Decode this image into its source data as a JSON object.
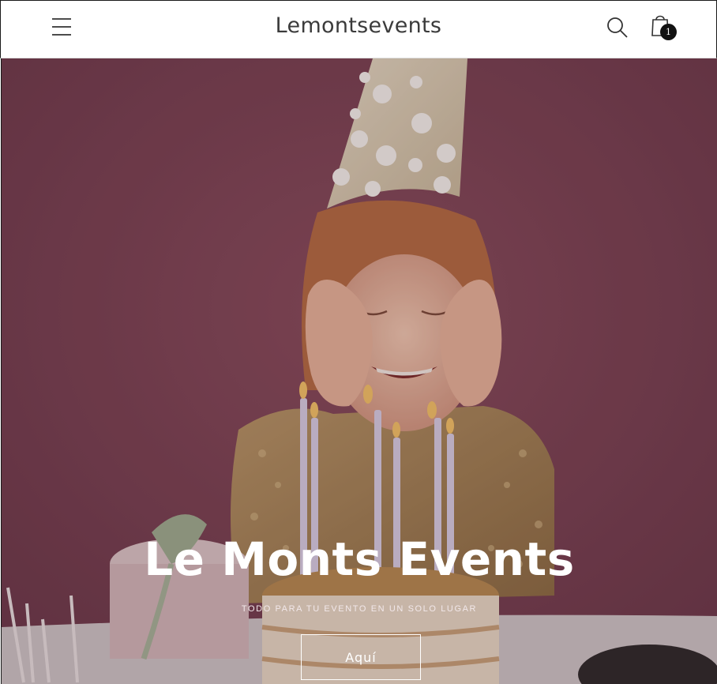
{
  "header": {
    "brand": "Lemontsevents",
    "cart_count": "1",
    "icons": {
      "menu": "hamburger-menu-icon",
      "search": "search-icon",
      "cart": "shopping-bag-icon"
    }
  },
  "hero": {
    "title": "Le Monts Events",
    "subtitle": "TODO PARA TU EVENTO EN UN SOLO LUGAR",
    "button_label": "Aquí",
    "overlay_color": "#7c4a5a"
  }
}
